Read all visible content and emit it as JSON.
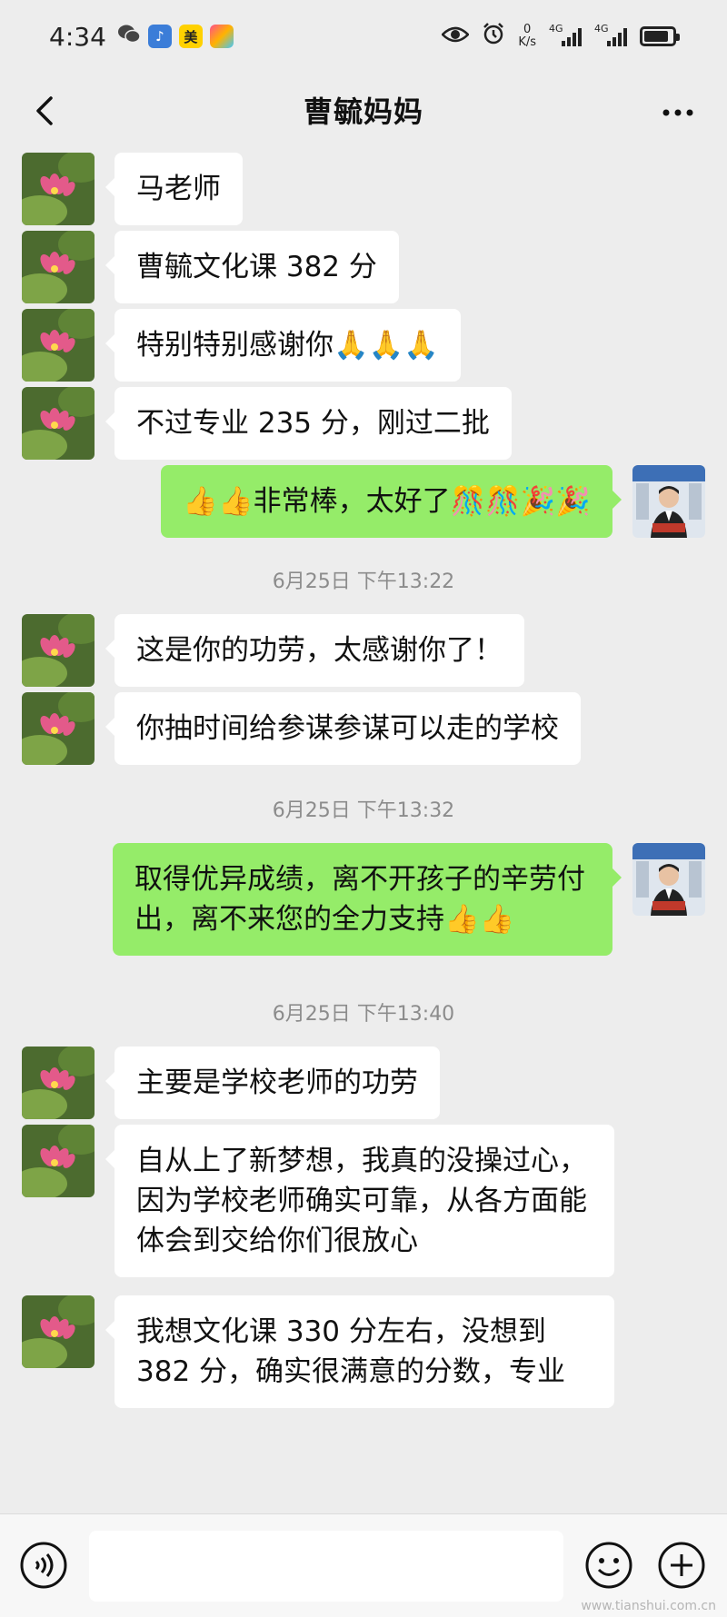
{
  "status_bar": {
    "time": "4:34",
    "net_speed_value": "0",
    "net_speed_unit": "K/s",
    "sim1": "4G",
    "sim2": "4G",
    "app_badge": "美"
  },
  "nav": {
    "title": "曹毓妈妈"
  },
  "messages": [
    {
      "side": "in",
      "text": "马老师"
    },
    {
      "side": "in",
      "text": "曹毓文化课 382 分"
    },
    {
      "side": "in",
      "text": "特别特别感谢你🙏🙏🙏"
    },
    {
      "side": "in",
      "text": "不过专业 235 分，刚过二批"
    },
    {
      "side": "out",
      "text": "👍👍非常棒，太好了🎊🎊🎉🎉"
    },
    {
      "side": "time",
      "text": "6月25日 下午13:22"
    },
    {
      "side": "in",
      "text": "这是你的功劳，太感谢你了！"
    },
    {
      "side": "in",
      "text": "你抽时间给参谋参谋可以走的学校"
    },
    {
      "side": "time",
      "text": "6月25日 下午13:32"
    },
    {
      "side": "out",
      "text": "取得优异成绩，离不开孩子的辛劳付出，离不来您的全力支持👍👍"
    },
    {
      "side": "time",
      "text": "6月25日 下午13:40"
    },
    {
      "side": "in",
      "text": "主要是学校老师的功劳"
    },
    {
      "side": "in",
      "text": "自从上了新梦想，我真的没操过心，因为学校老师确实可靠，从各方面能体会到交给你们很放心"
    },
    {
      "side": "in",
      "text": "我想文化课 330 分左右，没想到 382 分，确实很满意的分数，专业"
    }
  ],
  "input": {
    "value": ""
  },
  "watermark": "www.tianshui.com.cn",
  "colors": {
    "background": "#ededed",
    "incoming_bubble": "#ffffff",
    "outgoing_bubble": "#95ec69",
    "timestamp": "#8c8c8c"
  },
  "icons": {
    "back": "chevron-left-icon",
    "more": "more-dots-icon",
    "voice": "voice-icon",
    "emoji": "smile-icon",
    "plus": "plus-icon"
  }
}
